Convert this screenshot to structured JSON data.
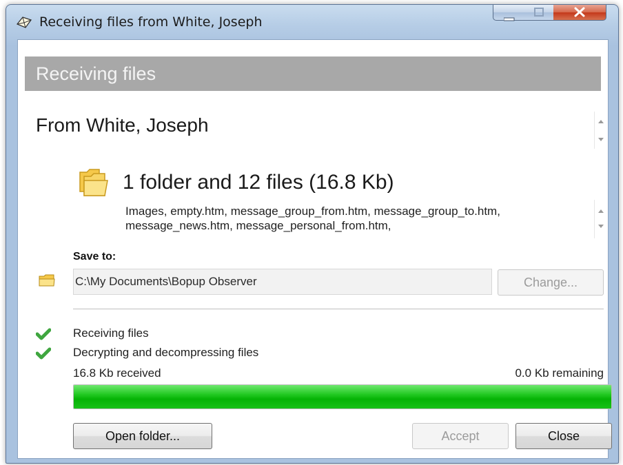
{
  "window": {
    "title": "Receiving files from White, Joseph"
  },
  "header": {
    "text": "Receiving files"
  },
  "sender": {
    "text": "From White, Joseph"
  },
  "files": {
    "summary": "1 folder and 12 files (16.8 Kb)",
    "list_line1": "Images, empty.htm, message_group_from.htm, message_group_to.htm,",
    "list_line2": "message_news.htm, message_personal_from.htm,"
  },
  "save": {
    "label": "Save to:",
    "path": "C:\\My Documents\\Bopup Observer",
    "change_label": "Change..."
  },
  "status": {
    "steps": [
      {
        "label": "Receiving files",
        "done": true
      },
      {
        "label": "Decrypting and decompressing files",
        "done": true
      }
    ],
    "received": "16.8 Kb received",
    "remaining": "0.0 Kb remaining",
    "progress_fraction": 1.0
  },
  "buttons": {
    "open_folder": "Open folder...",
    "accept": "Accept",
    "close": "Close"
  },
  "colors": {
    "header_band": "#a8a8a8",
    "progress_green": "#05b305",
    "check_green": "#3fa63f"
  },
  "icons": [
    "app-icon",
    "minimize-icon",
    "maximize-icon",
    "close-icon",
    "folder-icon",
    "checkmark-icon"
  ]
}
